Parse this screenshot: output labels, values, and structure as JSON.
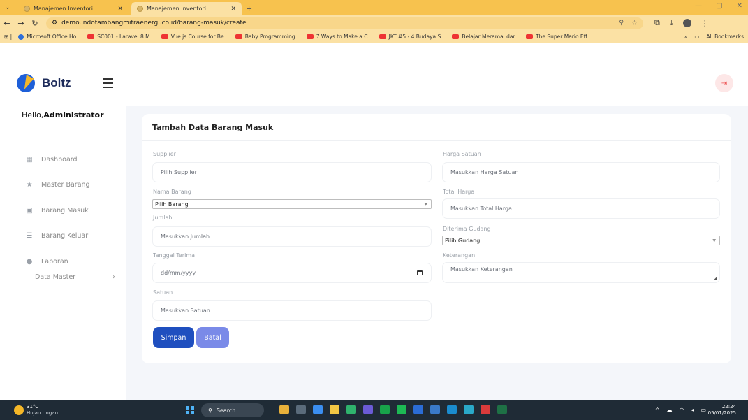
{
  "browser": {
    "tabs": [
      {
        "title": "Manajemen Inventori",
        "active": false
      },
      {
        "title": "Manajemen Inventori",
        "active": true
      }
    ],
    "url": "demo.indotambangmitraenergi.co.id/barang-masuk/create",
    "bookmarks": [
      "Microsoft Office Ho...",
      "SC001 - Laravel 8 M...",
      "Vue.js Course for Be...",
      "Baby Programming...",
      "7 Ways to Make a C...",
      "JKT #5 - 4 Budaya S...",
      "Belajar Meramal dar...",
      "The Super Mario Eff..."
    ],
    "all_bookmarks": "All Bookmarks",
    "more": "»"
  },
  "sidebar": {
    "brand": "Boltz",
    "greeting_prefix": "Hello,",
    "greeting_name": "Administrator",
    "items": [
      {
        "label": "Dashboard",
        "icon": "dashboard-icon"
      },
      {
        "label": "Master Barang",
        "icon": "star-icon"
      },
      {
        "label": "Barang Masuk",
        "icon": "inbox-icon"
      },
      {
        "label": "Barang Keluar",
        "icon": "list-icon"
      },
      {
        "label": "Laporan",
        "icon": "info-icon"
      }
    ],
    "data_master": "Data Master"
  },
  "form": {
    "title": "Tambah Data Barang Masuk",
    "supplier_label": "Supplier",
    "supplier_value": "Pilih Supplier",
    "nama_barang_label": "Nama Barang",
    "nama_barang_value": "Pilih Barang",
    "jumlah_label": "Jumlah",
    "jumlah_placeholder": "Masukkan Jumlah",
    "tanggal_label": "Tanggal Terima",
    "tanggal_placeholder": "dd/mm/yyyy",
    "satuan_label": "Satuan",
    "satuan_placeholder": "Masukkan Satuan",
    "harga_label": "Harga Satuan",
    "harga_placeholder": "Masukkan Harga Satuan",
    "total_label": "Total Harga",
    "total_placeholder": "Masukkan Total Harga",
    "gudang_label": "Diterima Gudang",
    "gudang_value": "Pilih Gudang",
    "keterangan_label": "Keterangan",
    "keterangan_placeholder": "Masukkan Keterangan",
    "save_label": "Simpan",
    "cancel_label": "Batal"
  },
  "taskbar": {
    "temp": "31°C",
    "weather": "Hujan ringan",
    "search": "Search",
    "time": "22:24",
    "date": "05/01/2025"
  }
}
